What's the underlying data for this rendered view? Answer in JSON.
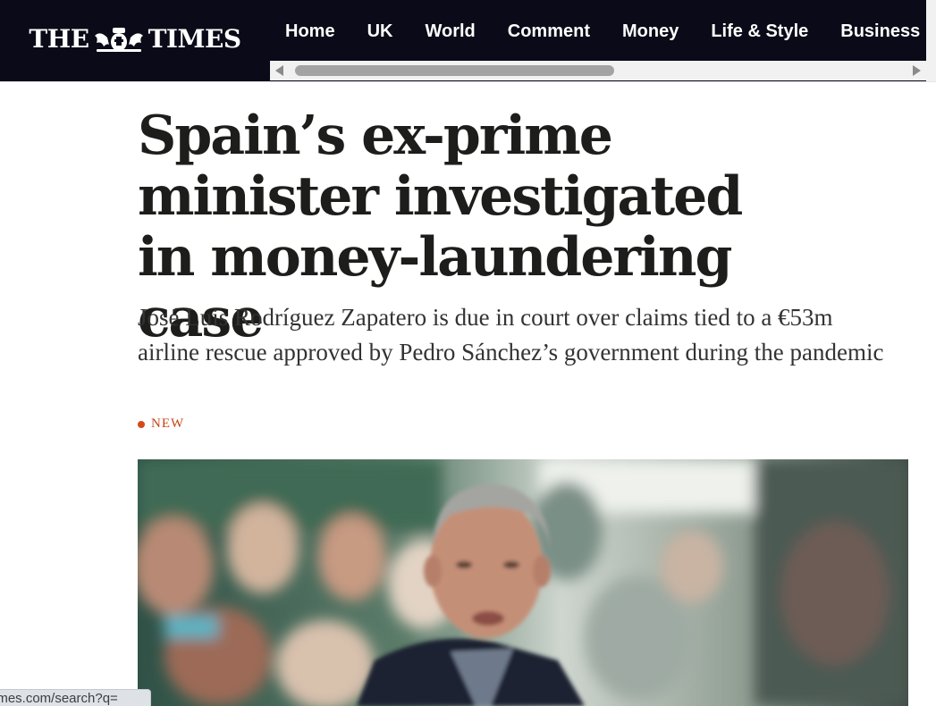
{
  "header": {
    "logo_left": "THE",
    "logo_right": "TIMES",
    "crest_icon": "royal-crest-icon",
    "nav": [
      {
        "label": "Home"
      },
      {
        "label": "UK"
      },
      {
        "label": "World"
      },
      {
        "label": "Comment"
      },
      {
        "label": "Money"
      },
      {
        "label": "Life & Style"
      },
      {
        "label": "Business"
      }
    ]
  },
  "article": {
    "headline": "Spain’s ex-prime minister investigated in money-laundering case",
    "standfirst": "José Luis Rodríguez Zapatero is due in court over claims tied to a €53m airline rescue approved by Pedro Sánchez’s government during the pandemic",
    "badge": "NEW"
  },
  "status_bar": {
    "url": "imes.com/search?q="
  },
  "colors": {
    "header_bg": "#0a0a18",
    "accent": "#d64a1a",
    "headline": "#1d1d1b"
  }
}
